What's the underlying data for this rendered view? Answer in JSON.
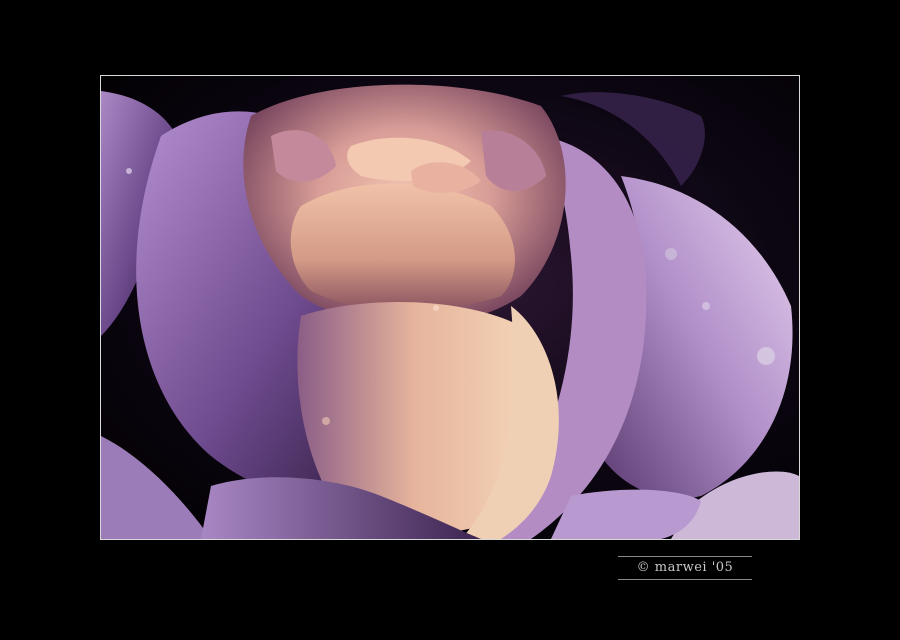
{
  "signature": {
    "text": "© marwei '05"
  },
  "colors": {
    "background": "#000000",
    "photo_border": "#d9d9d9",
    "signature_text": "#c9c9c9"
  },
  "photo": {
    "subject": "rose-flower"
  }
}
